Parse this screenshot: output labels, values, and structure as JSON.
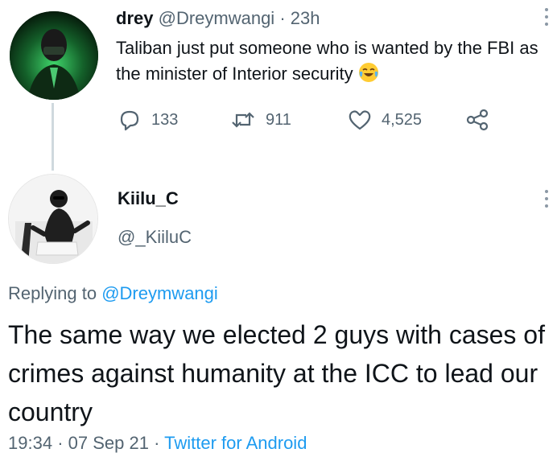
{
  "tweet": {
    "author_name": "drey",
    "author_handle": "@Dreymwangi",
    "separator": "·",
    "time": "23h",
    "text": "Taliban just put someone who is wanted by the FBI as the minister of Interior security",
    "emoji_icon": "face-with-tears-of-joy-icon",
    "actions": {
      "replies": "133",
      "retweets": "911",
      "likes": "4,525"
    }
  },
  "reply": {
    "author_name": "Kiilu_C",
    "author_handle": "@_KiiluC",
    "replying_prefix": "Replying to",
    "replying_to": "@Dreymwangi",
    "text": "The same way we elected 2 guys with cases of crimes against humanity at the ICC to lead our country",
    "time": "19:34",
    "date": "07 Sep 21",
    "separator": "·",
    "source": "Twitter for Android"
  },
  "colors": {
    "text_primary": "#0f1419",
    "text_secondary": "#536471",
    "link": "#1d9bf0",
    "divider": "#cfd9de"
  }
}
